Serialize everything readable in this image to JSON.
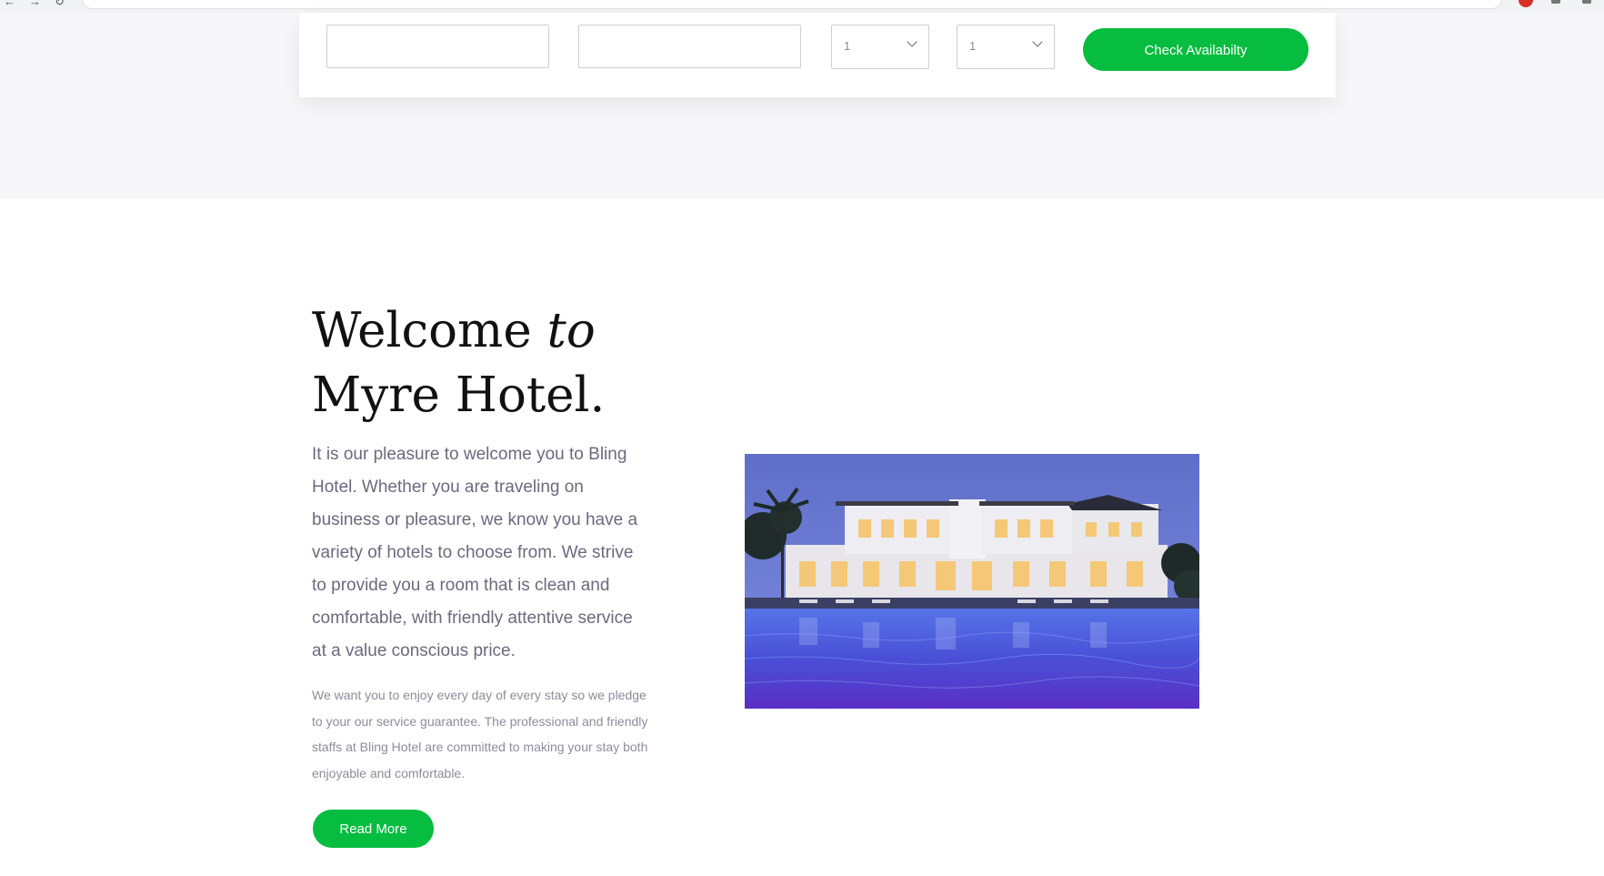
{
  "booking": {
    "check_in_value": "",
    "check_out_value": "",
    "adults_value": "1",
    "children_value": "1",
    "check_button_label": "Check Availabilty"
  },
  "welcome": {
    "title_prefix": "Welcome ",
    "title_italic": "to",
    "title_line2": "Myre Hotel.",
    "lead": "It is our pleasure to welcome you to Bling Hotel. Whether you are traveling on business or pleasure, we know you have a variety of hotels to choose from. We strive to provide you a room that is clean and comfortable, with friendly attentive service at a value conscious price.",
    "sub": "We want you to enjoy every day of every stay so we pledge to your our service guarantee. The professional and friendly staffs at Bling Hotel are committed to making your stay both enjoyable and comfortable.",
    "read_more_label": "Read More"
  },
  "colors": {
    "accent": "#06bd3f",
    "band_background": "#f7f7f9",
    "body_text": "#6a6a7d",
    "heading": "#111111"
  },
  "icons": {
    "select_arrow": "chevron-down-icon"
  }
}
